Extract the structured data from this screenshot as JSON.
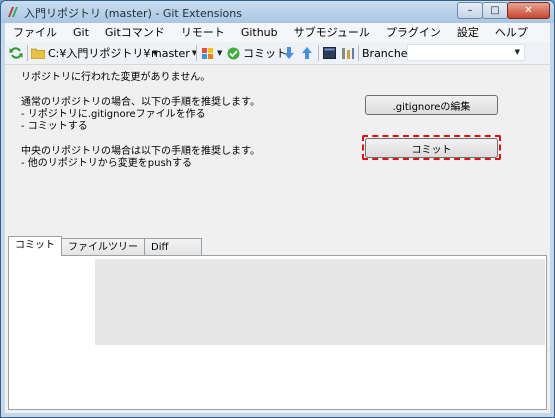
{
  "window": {
    "title": "入門リポジトリ (master) - Git Extensions",
    "controls": {
      "minimize": "–",
      "maximize": "□",
      "close": "✕"
    }
  },
  "menu": {
    "items": [
      "ファイル",
      "Git",
      "Gitコマンド",
      "リモート",
      "Github",
      "サブモジュール",
      "プラグイン",
      "設定",
      "ヘルプ"
    ]
  },
  "toolbar": {
    "repo_path": "C:¥入門リポジトリ¥",
    "branch": "master",
    "commit_label": "コミット",
    "branches_label": "Branches:"
  },
  "content": {
    "no_changes": "リポジトリに行われた変更がありません。",
    "normal_heading": "通常のリポジトリの場合、以下の手順を推奨します。",
    "normal_step1": "- リポジトリに.gitignoreファイルを作る",
    "normal_step2": "- コミットする",
    "central_heading": "中央のリポジトリの場合は以下の手順を推奨します。",
    "central_step1": "- 他のリポジトリから変更をpushする",
    "gitignore_button": ".gitignoreの編集",
    "commit_button": "コミット"
  },
  "tabs": [
    "コミット",
    "ファイルツリー",
    "Diff"
  ],
  "colors": {
    "highlight": "#e01010",
    "title_bar": "#b9d1ea"
  },
  "icons": [
    "git-extensions-app-icon",
    "refresh-icon",
    "folder-icon",
    "branch-icon",
    "stash-icon",
    "commit-check-icon",
    "pull-icon",
    "push-icon",
    "console-icon",
    "settings-icon"
  ]
}
